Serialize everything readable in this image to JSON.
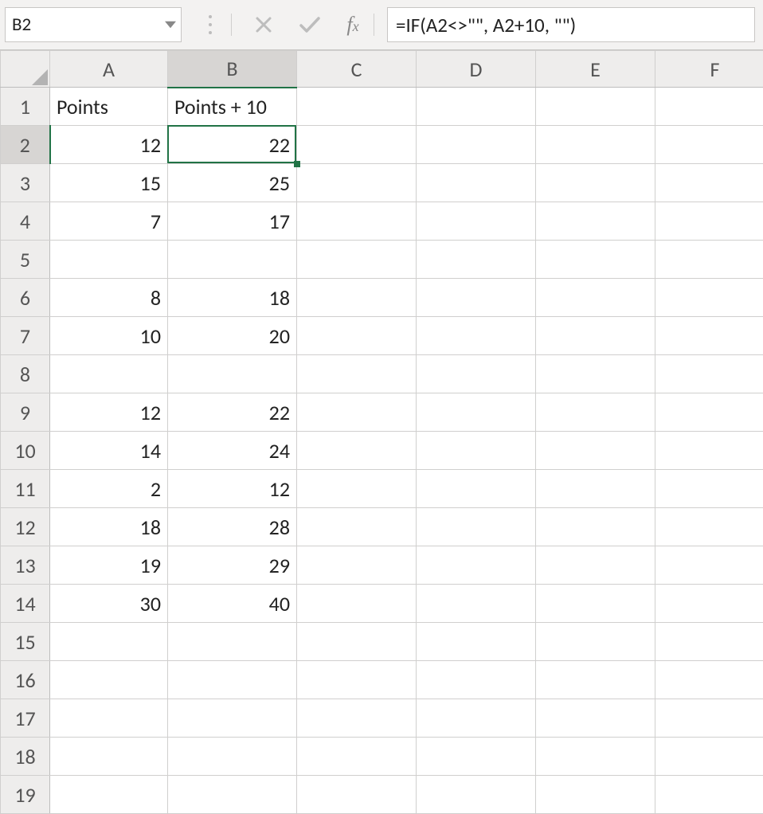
{
  "name_box": {
    "value": "B2"
  },
  "formula_bar": {
    "formula": "=IF(A2<>\"\", A2+10, \"\")"
  },
  "column_letters": [
    "A",
    "B",
    "C",
    "D",
    "E",
    "F"
  ],
  "row_numbers": [
    "1",
    "2",
    "3",
    "4",
    "5",
    "6",
    "7",
    "8",
    "9",
    "10",
    "11",
    "12",
    "13",
    "14",
    "15",
    "16",
    "17",
    "18",
    "19"
  ],
  "headers": {
    "A": "Points",
    "B": "Points + 10"
  },
  "cells": {
    "A2": "12",
    "B2": "22",
    "A3": "15",
    "B3": "25",
    "A4": "7",
    "B4": "17",
    "A6": "8",
    "B6": "18",
    "A7": "10",
    "B7": "20",
    "A9": "12",
    "B9": "22",
    "A10": "14",
    "B10": "24",
    "A11": "2",
    "B11": "12",
    "A12": "18",
    "B12": "28",
    "A13": "19",
    "B13": "29",
    "A14": "30",
    "B14": "40"
  },
  "selection": {
    "cell": "B2",
    "col": "B",
    "row": "2"
  }
}
